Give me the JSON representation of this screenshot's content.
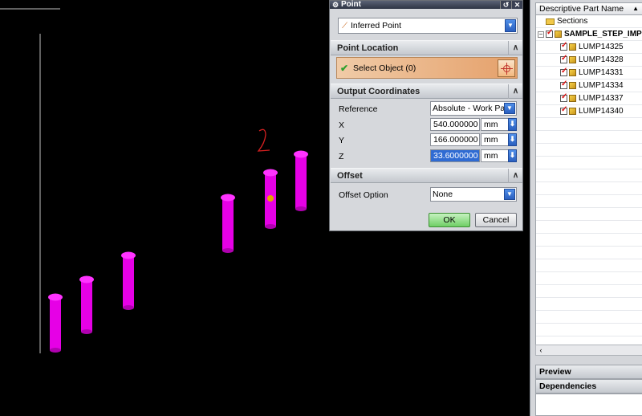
{
  "dialog": {
    "title": "Point",
    "type_dropdown": "Inferred Point",
    "sections": {
      "point_location": "Point Location",
      "output_coordinates": "Output Coordinates",
      "offset": "Offset"
    },
    "select_object": "Select Object (0)",
    "reference_label": "Reference",
    "reference_value": "Absolute - Work Part",
    "x_label": "X",
    "x_value": "540.000000",
    "y_label": "Y",
    "y_value": "166.000000",
    "z_label": "Z",
    "z_value": "33.6000000",
    "unit": "mm",
    "offset_option_label": "Offset Option",
    "offset_option_value": "None",
    "ok_label": "OK",
    "cancel_label": "Cancel"
  },
  "viewport": {
    "annotation": "2",
    "cylinder_color": "#e600e6",
    "point_color": "#e8a200"
  },
  "navigator": {
    "column_header": "Descriptive Part Name",
    "items": [
      {
        "label": "Sections",
        "type": "folder"
      },
      {
        "label": "SAMPLE_STEP_IMP",
        "type": "assembly"
      },
      {
        "label": "LUMP14325",
        "type": "part"
      },
      {
        "label": "LUMP14328",
        "type": "part"
      },
      {
        "label": "LUMP14331",
        "type": "part"
      },
      {
        "label": "LUMP14334",
        "type": "part"
      },
      {
        "label": "LUMP14337",
        "type": "part"
      },
      {
        "label": "LUMP14340",
        "type": "part"
      }
    ],
    "preview_label": "Preview",
    "dependencies_label": "Dependencies"
  }
}
